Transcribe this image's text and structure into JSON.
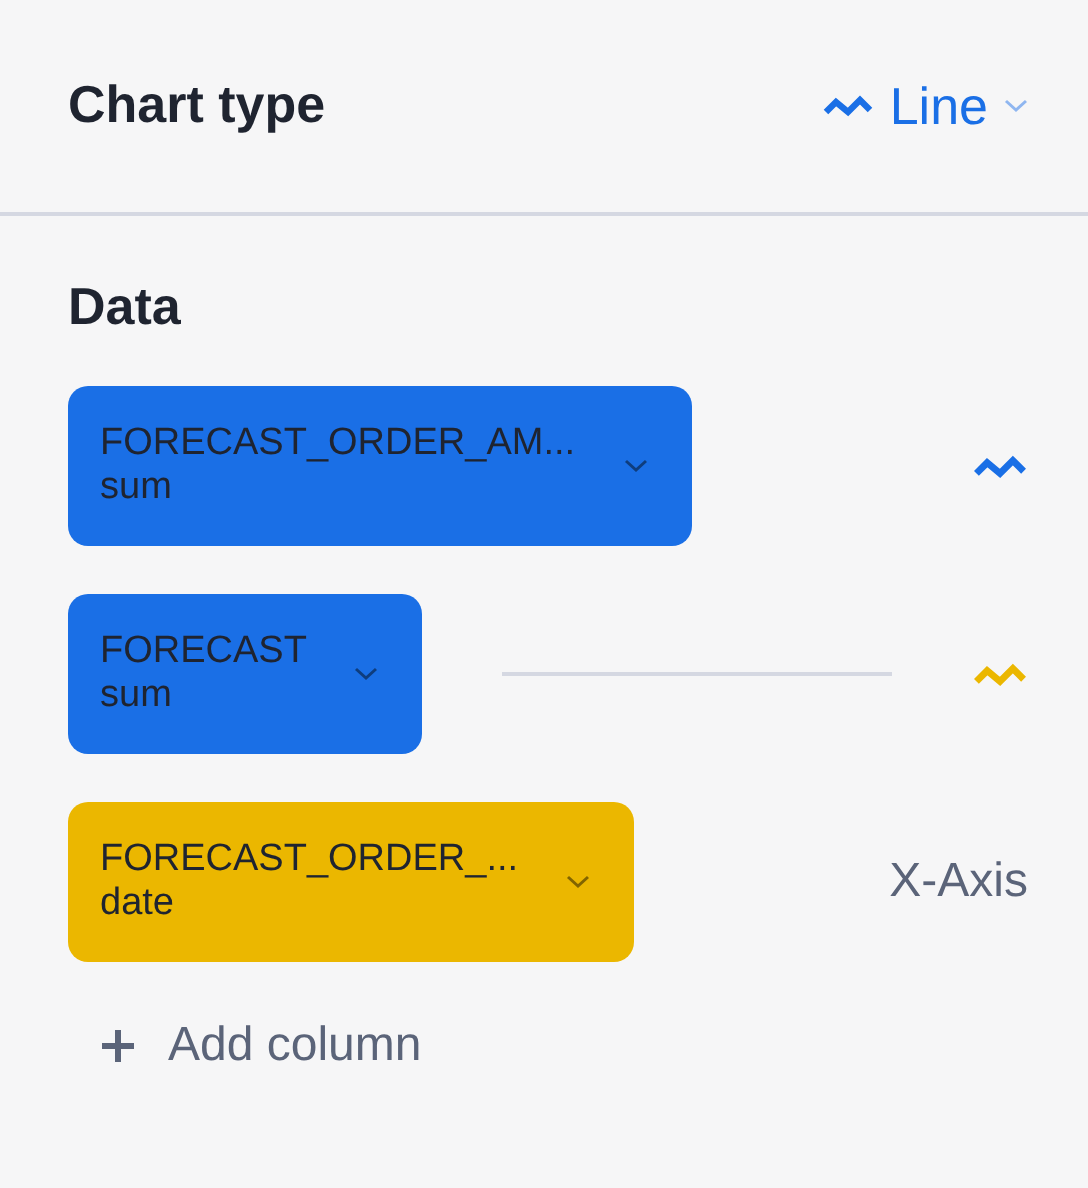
{
  "chart_type": {
    "label": "Chart type",
    "value": "Line"
  },
  "data": {
    "heading": "Data",
    "columns": [
      {
        "kind": "series",
        "name": "FORECAST_ORDER_AM...",
        "aggregation": "sum",
        "color": "#1a6fe6",
        "drop_indicator": false,
        "series": {
          "color": "#1a6fe6"
        }
      },
      {
        "kind": "series",
        "name": "FORECAST",
        "aggregation": "sum",
        "color": "#1a6fe6",
        "drop_indicator": true,
        "series": {
          "color": "#ebb700"
        }
      },
      {
        "kind": "x-axis",
        "name": "FORECAST_ORDER_...",
        "aggregation": "date",
        "color": "#ebb700",
        "role_label": "X-Axis"
      }
    ],
    "add_button": "Add column"
  }
}
